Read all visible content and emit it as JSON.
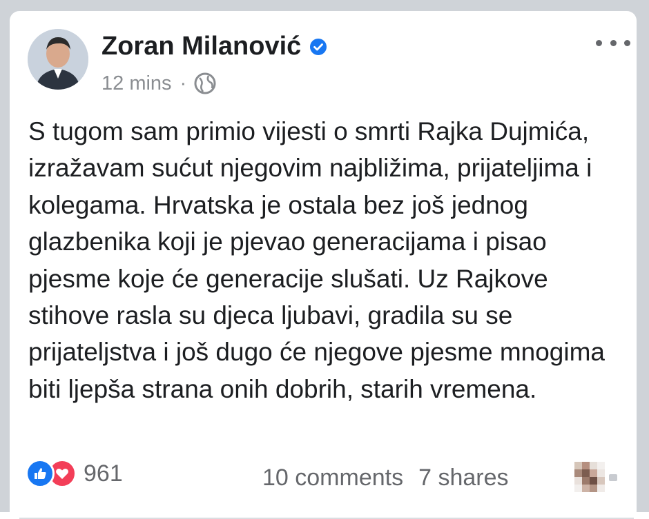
{
  "post": {
    "author_name": "Zoran Milanović",
    "timestamp": "12 mins",
    "separator": "·",
    "privacy_icon": "globe-icon",
    "verified_icon": "verified-badge-icon",
    "more_icon": "more-options-icon",
    "text": "S tugom sam primio vijesti o smrti Rajka Dujmića, izražavam sućut njegovim najbližima, prijateljima i kolegama. Hrvatska je ostala bez još jednog glazbenika koji je pjevao generacijama i pisao pjesme koje će generacije slušati. Uz Rajkove stihove rasla su djeca ljubavi, gradila su se prijateljstva i još dugo će njegove pjesme mnogima biti ljepša strana onih dobrih, starih vremena."
  },
  "footer": {
    "reaction_count": "961",
    "reaction_icons": [
      "like-icon",
      "love-icon"
    ],
    "comments": "10 comments",
    "shares": "7 shares"
  },
  "colors": {
    "verified_blue": "#1877f2",
    "like_blue": "#1877f2",
    "love_red": "#f33e58",
    "text_primary": "#1c1e21",
    "text_secondary": "#65676b"
  }
}
